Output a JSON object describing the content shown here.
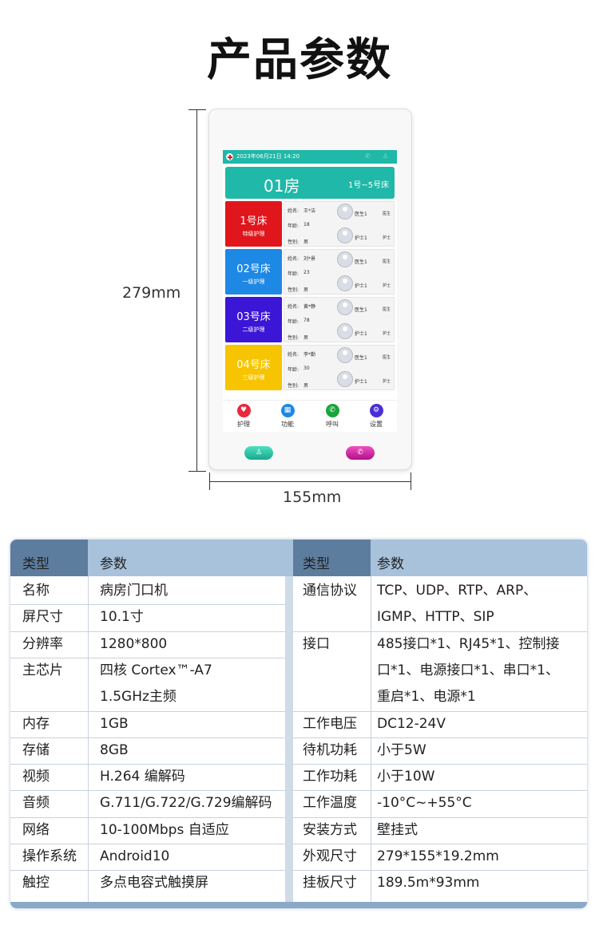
{
  "title": "产品参数",
  "dimensions": {
    "height": "279mm",
    "width": "155mm"
  },
  "device": {
    "status": {
      "datetime": "2023年06月21日   14:20",
      "phone_icon": "phone-icon",
      "user_icon": "user-icon"
    },
    "room": {
      "number": "01房",
      "range": "1号~5号床"
    },
    "field_labels": {
      "name": "姓名:",
      "age": "年龄:",
      "gender": "性别:"
    },
    "beds": [
      {
        "bed": "1号床",
        "level": "特级护理",
        "color": "#e0161c",
        "name": "王*洁",
        "age": "18",
        "gender": "男",
        "doctor": "医生1",
        "doctor_role": "医生",
        "nurse": "护士1",
        "nurse_role": "护士"
      },
      {
        "bed": "02号床",
        "level": "一级护理",
        "color": "#1e88e5",
        "name": "刘*景",
        "age": "23",
        "gender": "男",
        "doctor": "医生1",
        "doctor_role": "医生",
        "nurse": "护士1",
        "nurse_role": "护士"
      },
      {
        "bed": "03号床",
        "level": "二级护理",
        "color": "#3c16d6",
        "name": "黄*静",
        "age": "78",
        "gender": "男",
        "doctor": "医生1",
        "doctor_role": "医生",
        "nurse": "护士1",
        "nurse_role": "护士"
      },
      {
        "bed": "04号床",
        "level": "三级护理",
        "color": "#f6c400",
        "name": "李*勤",
        "age": "30",
        "gender": "男",
        "doctor": "医生1",
        "doctor_role": "医生",
        "nurse": "护士1",
        "nurse_role": "护士"
      }
    ],
    "nav": [
      {
        "label": "护理",
        "icon": "heart-icon",
        "color": "#e8283c"
      },
      {
        "label": "功能",
        "icon": "grid-icon",
        "color": "#1e88e5"
      },
      {
        "label": "呼叫",
        "icon": "phone-icon",
        "color": "#1aa53a"
      },
      {
        "label": "设置",
        "icon": "gear-icon",
        "color": "#4a2fd6"
      }
    ],
    "hw_buttons": [
      {
        "icon": "user-icon",
        "color": "#20b8a8"
      },
      {
        "icon": "phone-icon",
        "color": "#c8189a"
      }
    ]
  },
  "table": {
    "headers": {
      "type": "类型",
      "param": "参数"
    },
    "left": [
      {
        "k": "名称",
        "v": "病房门口机"
      },
      {
        "k": "屏尺寸",
        "v": "10.1寸"
      },
      {
        "k": "分辨率",
        "v": "1280*800"
      },
      {
        "k": "主芯片",
        "v": "四核 Cortex™-A7",
        "v2": "1.5GHz主频"
      },
      {
        "k": "内存",
        "v": "1GB"
      },
      {
        "k": "存储",
        "v": "8GB"
      },
      {
        "k": "视频",
        "v": "H.264 编解码"
      },
      {
        "k": "音频",
        "v": "G.711/G.722/G.729编解码"
      },
      {
        "k": "网络",
        "v": "10-100Mbps 自适应"
      },
      {
        "k": "操作系统",
        "v": "Android10"
      },
      {
        "k": "触控",
        "v": "多点电容式触摸屏"
      }
    ],
    "right": [
      {
        "k": "通信协议",
        "v": "TCP、UDP、RTP、ARP、",
        "v2": "IGMP、HTTP、SIP"
      },
      {
        "k": "接口",
        "v": "485接口*1、RJ45*1、控制接",
        "v2": "口*1、电源接口*1、串口*1、",
        "v3": "重启*1、电源*1"
      },
      {
        "k": "工作电压",
        "v": "DC12-24V"
      },
      {
        "k": "待机功耗",
        "v": "小于5W"
      },
      {
        "k": "工作功耗",
        "v": "小于10W"
      },
      {
        "k": "工作温度",
        "v": "-10°C~+55°C"
      },
      {
        "k": "安装方式",
        "v": "壁挂式"
      },
      {
        "k": "外观尺寸",
        "v": "279*155*19.2mm"
      },
      {
        "k": "挂板尺寸",
        "v": "189.5m*93mm"
      }
    ]
  }
}
